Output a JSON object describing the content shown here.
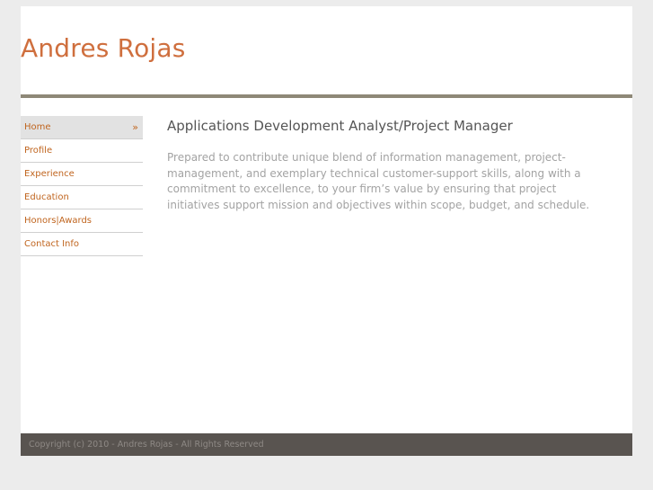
{
  "header": {
    "site_title": "Andres Rojas"
  },
  "nav": {
    "items": [
      {
        "label": "Home",
        "active": true,
        "arrow": "»"
      },
      {
        "label": "Profile"
      },
      {
        "label": "Experience"
      },
      {
        "label": "Education"
      },
      {
        "label": "Honors|Awards"
      },
      {
        "label": "Contact Info"
      }
    ]
  },
  "main": {
    "heading": "Applications Development Analyst/Project Manager",
    "body": "Prepared to contribute unique blend of information management, project-management, and exemplary technical customer-support skills, along with a commitment to excellence, to your firm’s value by ensuring that project initiatives support mission and objectives within scope, budget, and schedule."
  },
  "footer": {
    "copyright": "Copyright (c) 2010 - Andres Rojas - All Rights Reserved"
  },
  "colors": {
    "accent": "#cf6f3e",
    "nav_link": "#c0651f",
    "header_rule": "#8e8877",
    "footer_bg": "#595450",
    "page_bg": "#ececec"
  }
}
